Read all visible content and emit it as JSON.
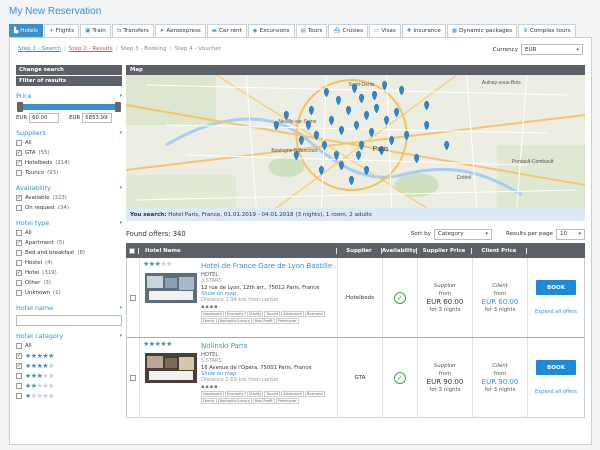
{
  "page_title": "My New Reservation",
  "tabs": [
    {
      "icon": "hotel-icon",
      "glyph": "▙",
      "label": "Hotels",
      "active": true
    },
    {
      "icon": "flight-icon",
      "glyph": "✈",
      "label": "Flights"
    },
    {
      "icon": "train-icon",
      "glyph": "▣",
      "label": "Train"
    },
    {
      "icon": "transfer-icon",
      "glyph": "⇆",
      "label": "Transfers"
    },
    {
      "icon": "aeroexpress-icon",
      "glyph": "➤",
      "label": "Aeroexpress"
    },
    {
      "icon": "car-icon",
      "glyph": "▬",
      "label": "Car rent"
    },
    {
      "icon": "excursion-icon",
      "glyph": "◉",
      "label": "Excursions"
    },
    {
      "icon": "tour-icon",
      "glyph": "▤",
      "label": "Tours"
    },
    {
      "icon": "cruise-icon",
      "glyph": "⛴",
      "label": "Cruises"
    },
    {
      "icon": "visa-icon",
      "glyph": "▭",
      "label": "Visas"
    },
    {
      "icon": "insurance-icon",
      "glyph": "✚",
      "label": "Insurance"
    },
    {
      "icon": "package-icon",
      "glyph": "▦",
      "label": "Dynamic packages"
    },
    {
      "icon": "complex-tour-icon",
      "glyph": "⚙",
      "label": "Complex tours"
    }
  ],
  "steps": {
    "s1": "Step 1 - Search",
    "s2": "Step 2 - Results",
    "s3": "Step 3 - Booking",
    "s4": "Step 4 - Voucher",
    "sep": "|"
  },
  "currency": {
    "label": "Currency",
    "value": "EUR"
  },
  "sidebar": {
    "change_search": "Change search",
    "filter_results": "Filter of results",
    "price": {
      "title": "Price",
      "currency_min": "EUR",
      "min": "60.00",
      "currency_max": "EUR",
      "max": "5853.99"
    },
    "suppliers": {
      "title": "Suppliers",
      "items": [
        {
          "label": "All",
          "count": "",
          "checked": false
        },
        {
          "label": "GTA",
          "count": "(55)",
          "checked": true
        },
        {
          "label": "Hotelbeds",
          "count": "(214)",
          "checked": true
        },
        {
          "label": "Tourico",
          "count": "(93)",
          "checked": false
        }
      ]
    },
    "availability": {
      "title": "Availability",
      "items": [
        {
          "label": "Available",
          "count": "(323)",
          "checked": true
        },
        {
          "label": "On request",
          "count": "(34)",
          "checked": false
        }
      ]
    },
    "hotel_type": {
      "title": "Hotel type",
      "items": [
        {
          "label": "All",
          "count": "",
          "checked": false
        },
        {
          "label": "Apartment",
          "count": "(5)",
          "checked": true
        },
        {
          "label": "Bed and breakfast",
          "count": "(8)",
          "checked": false
        },
        {
          "label": "Hostel",
          "count": "(4)",
          "checked": false
        },
        {
          "label": "Hotel",
          "count": "(319)",
          "checked": true
        },
        {
          "label": "Other",
          "count": "(3)",
          "checked": false
        },
        {
          "label": "Unknown",
          "count": "(1)",
          "checked": false
        }
      ]
    },
    "hotel_name": {
      "title": "Hotel name"
    },
    "hotel_category": {
      "title": "Hotel category",
      "items": [
        {
          "label": "All",
          "stars": 0,
          "checked": false
        },
        {
          "label": "",
          "stars": 5,
          "checked": true
        },
        {
          "label": "",
          "stars": 4,
          "checked": true
        },
        {
          "label": "",
          "stars": 3,
          "checked": false
        },
        {
          "label": "",
          "stars": 2,
          "checked": false
        },
        {
          "label": "",
          "stars": 1,
          "checked": false
        }
      ]
    }
  },
  "map": {
    "title": "Map",
    "places": [
      "Saint-Denis",
      "Aulnay-sous-Bois",
      "Neuilly-sur-Seine",
      "Boulogne-Billancourt",
      "Créteil",
      "Pontault-Combault",
      "Paris"
    ]
  },
  "search_info": {
    "prefix": "You search:",
    "text": "Hotel Paris, France, 01.01.2019 - 04.01.2018 (3 nights), 1 room, 2 adults"
  },
  "results": {
    "found": "Found offers: 340",
    "sort_label": "Sort by",
    "sort_value": "Category",
    "per_page_label": "Results per page",
    "per_page_value": "10"
  },
  "table": {
    "headers": {
      "name": "Hotel Name",
      "supplier": "Supplier",
      "availability": "Availability",
      "supplier_price": "Supplier Price",
      "client_price": "Client Price"
    },
    "rows": [
      {
        "name": "Hotel de France Gare de Lyon Bastille",
        "type": "HOTEL",
        "stars_label": "3 STARS",
        "stars": 3,
        "address": "12 rue de Lyon, 12th arr., 75012 Paris, France",
        "show_map": "Show on map",
        "distance": "Distance 1.94 km from center",
        "tags": [
          "Downtown",
          "Economy",
          "Quality",
          "Tourist",
          "Adventure",
          "Business",
          "Family",
          "Romantic/Luxury",
          "Non-Profit",
          "Freelancer"
        ],
        "supplier": "Hotelbeds",
        "supplier_price_label": "Supplier",
        "supplier_from": "from",
        "supplier_price": "EUR 60.00",
        "supplier_nights": "for 3 nights",
        "client_price_label": "Client",
        "client_from": "from",
        "client_price": "EUR 60.00",
        "client_nights": "for 3 nights",
        "book": "BOOK",
        "expand": "Expand all offers"
      },
      {
        "name": "Nolinski Paris",
        "type": "HOTEL",
        "stars_label": "5 STARS",
        "stars": 5,
        "address": "16 Avenue de l'Opéra, 75001 Paris, France",
        "show_map": "Show on map",
        "distance": "Distance 1.69 km from center",
        "tags": [
          "Downtown",
          "Economy",
          "Quality",
          "Tourist",
          "Adventure",
          "Business",
          "Family",
          "Romantic/Luxury",
          "Non-Profit",
          "Freelancer"
        ],
        "supplier": "GTA",
        "supplier_price_label": "Supplier",
        "supplier_from": "from",
        "supplier_price": "EUR 90.00",
        "supplier_nights": "for 3 nights",
        "client_price_label": "Client",
        "client_from": "from",
        "client_price": "EUR 90.00",
        "client_nights": "for 3 nights",
        "book": "BOOK",
        "expand": "Expand all offers"
      }
    ]
  },
  "colors": {
    "accent": "#3a8fd0",
    "dark_bar": "#5b6166",
    "book": "#1f88d9",
    "available": "#3aa53a",
    "step_active": "#d9534f"
  }
}
